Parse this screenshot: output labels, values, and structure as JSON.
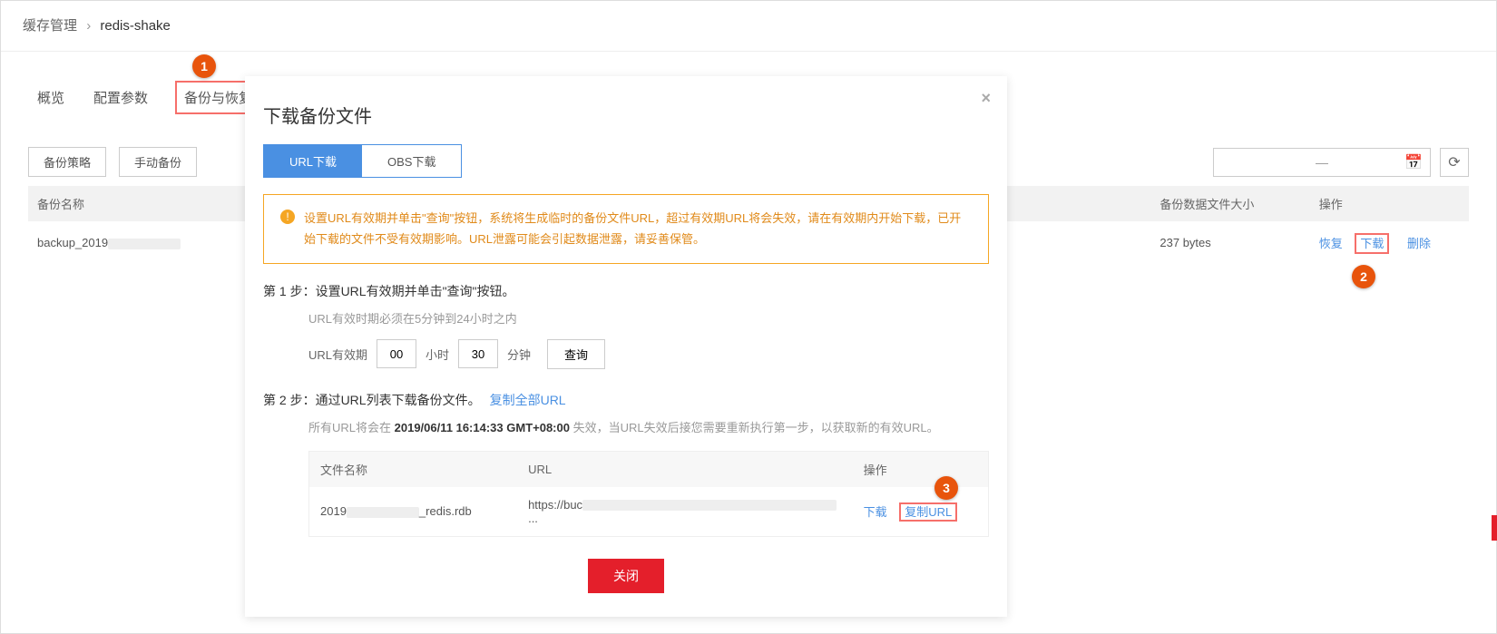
{
  "breadcrumb": {
    "parent": "缓存管理",
    "current": "redis-shake"
  },
  "tabs": [
    "概览",
    "配置参数",
    "备份与恢复"
  ],
  "toolbar": {
    "backup_strategy": "备份策略",
    "manual_backup": "手动备份",
    "date_placeholder": "—"
  },
  "table": {
    "headers": {
      "name": "备份名称",
      "size": "备份数据文件大小",
      "ops": "操作"
    },
    "row": {
      "name_prefix": "backup_2019",
      "size": "237 bytes",
      "ops": {
        "restore": "恢复",
        "download": "下载",
        "delete": "删除"
      }
    }
  },
  "modal": {
    "title": "下载备份文件",
    "seg": {
      "url": "URL下载",
      "obs": "OBS下载"
    },
    "alert": "设置URL有效期并单击\"查询\"按钮，系统将生成临时的备份文件URL，超过有效期URL将会失效，请在有效期内开始下载，已开始下载的文件不受有效期影响。URL泄露可能会引起数据泄露，请妥善保管。",
    "step1": "第 1 步：设置URL有效期并单击\"查询\"按钮。",
    "step1_hint": "URL有效时期必须在5分钟到24小时之内",
    "expiry_label": "URL有效期",
    "hours": "00",
    "hours_unit": "小时",
    "minutes": "30",
    "minutes_unit": "分钟",
    "query": "查询",
    "step2": "第 2 步：通过URL列表下载备份文件。",
    "copy_all": "复制全部URL",
    "expire_prefix": "所有URL将会在",
    "expire_time": "2019/06/11 16:14:33 GMT+08:00",
    "expire_suffix": "失效，当URL失效后接您需要重新执行第一步，以获取新的有效URL。",
    "file_headers": {
      "name": "文件名称",
      "url": "URL",
      "ops": "操作"
    },
    "file_row": {
      "name_prefix": "2019",
      "name_suffix": "_redis.rdb",
      "url_prefix": "https://buc",
      "download": "下载",
      "copy": "复制URL"
    },
    "close": "关闭"
  },
  "badges": {
    "b1": "1",
    "b2": "2",
    "b3": "3"
  }
}
